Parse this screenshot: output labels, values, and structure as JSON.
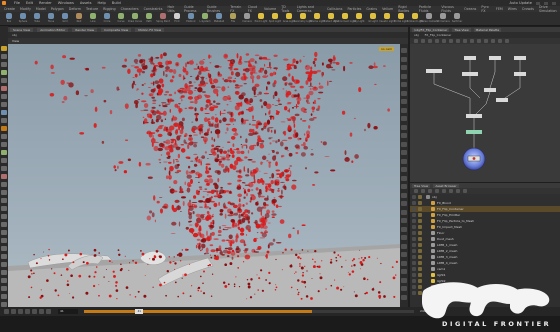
{
  "app": {
    "menu": [
      "File",
      "Edit",
      "Render",
      "Windows",
      "Assets",
      "Help"
    ],
    "desktop": "Build",
    "right_status": "Auto Update"
  },
  "shelf_tabs": [
    "Create",
    "Modify",
    "Model",
    "Polygon",
    "Deform",
    "Texture",
    "Rigging",
    "Characters",
    "Constraints",
    "Hair Utils",
    "Guide Process",
    "Guide Brushes",
    "Terrain FX",
    "Cloud FX",
    "Volume",
    "TD Tools",
    "Lights and Cameras",
    "Collisions",
    "Particles",
    "Grains",
    "Vellum",
    "Rigid Bodies",
    "Particle Fluids",
    "Viscous Fluids",
    "Oceans",
    "Pyro FX",
    "FEM",
    "Wires",
    "Crowds",
    "Drive Simulation"
  ],
  "shelf_tools": [
    {
      "label": "Box",
      "color": "#6f8fb0"
    },
    {
      "label": "Sphere",
      "color": "#6f8fb0"
    },
    {
      "label": "Tube",
      "color": "#6f8fb0"
    },
    {
      "label": "Torus",
      "color": "#6f8fb0"
    },
    {
      "label": "Grid",
      "color": "#6f8fb0"
    },
    {
      "label": "Null",
      "color": "#b08a5a"
    },
    {
      "label": "Line",
      "color": "#8fb06f"
    },
    {
      "label": "Circle",
      "color": "#6f8fb0"
    },
    {
      "label": "Curve",
      "color": "#8fb06f"
    },
    {
      "label": "Draw Curve",
      "color": "#8fb06f"
    },
    {
      "label": "Path",
      "color": "#8fb06f"
    },
    {
      "label": "Spray Paint",
      "color": "#b06f6f"
    },
    {
      "label": "Font",
      "color": "#cfcfcf"
    },
    {
      "label": "Platonic",
      "color": "#6f8fb0"
    },
    {
      "label": "L-System",
      "color": "#8fb06f"
    },
    {
      "label": "Metaball",
      "color": "#6f8fb0"
    },
    {
      "label": "File",
      "color": "#b0a05a"
    },
    {
      "label": "Camera",
      "color": "#9a9a9a"
    },
    {
      "label": "Point Light",
      "color": "#e0c040"
    },
    {
      "label": "Spot Light",
      "color": "#e0c040"
    },
    {
      "label": "Area Light",
      "color": "#e0c040"
    },
    {
      "label": "Geometry Light",
      "color": "#e0c040"
    },
    {
      "label": "Volume Light",
      "color": "#e0c040"
    },
    {
      "label": "Distant Light",
      "color": "#e0c040"
    },
    {
      "label": "Environment Light",
      "color": "#e0c040"
    },
    {
      "label": "Sky Light",
      "color": "#e0c040"
    },
    {
      "label": "GI Light",
      "color": "#e0c040"
    },
    {
      "label": "Caustic Light",
      "color": "#e0c040"
    },
    {
      "label": "Portal Light",
      "color": "#e0c040"
    },
    {
      "label": "Ambient Light",
      "color": "#e0c040"
    },
    {
      "label": "Stereo Camera",
      "color": "#9a9a9a"
    },
    {
      "label": "VR Camera",
      "color": "#9a9a9a"
    },
    {
      "label": "Switcher",
      "color": "#9a9a9a"
    }
  ],
  "viewport": {
    "tabs": [
      "Scene View",
      "Animation Editor",
      "Render View",
      "Composite View",
      "Motion FX View"
    ],
    "path": "obj",
    "view_label": "View",
    "camera_label": "no cam",
    "colors": {
      "particles": "#d81c1c",
      "particles_dark": "#8a0f12",
      "ground": "#b9b9b9"
    }
  },
  "network": {
    "tabs": [
      "/obj/FX_Flip_Container",
      "Tree View",
      "Material Palette"
    ],
    "path": [
      "obj",
      "FX_Flip_Container"
    ],
    "node_label": "FX_Flip_Container"
  },
  "tree": {
    "tabs": [
      "Tree View",
      "Asset Browser"
    ],
    "rows": [
      {
        "label": "obj",
        "depth": 0,
        "color": "#8a8a8a"
      },
      {
        "label": "FX_Blood",
        "depth": 1,
        "color": "#d0a040"
      },
      {
        "label": "FX_Flip_Container",
        "depth": 1,
        "color": "#d0a040",
        "selected": true
      },
      {
        "label": "FX_Flip_Emitter",
        "depth": 1,
        "color": "#d0a040"
      },
      {
        "label": "FX_Flip_Particle_to_Mesh",
        "depth": 1,
        "color": "#d0a040"
      },
      {
        "label": "FX_Impact_Mesh",
        "depth": 1,
        "color": "#d0a040"
      },
      {
        "label": "Floor",
        "depth": 1,
        "color": "#9a9a9a"
      },
      {
        "label": "Dust_mesh",
        "depth": 1,
        "color": "#9a9a9a"
      },
      {
        "label": "LIMB_1_mesh",
        "depth": 1,
        "color": "#9a9a9a"
      },
      {
        "label": "LIMB_2_mesh",
        "depth": 1,
        "color": "#9a9a9a"
      },
      {
        "label": "LIMB_3_mesh",
        "depth": 1,
        "color": "#9a9a9a"
      },
      {
        "label": "LIMB_4_mesh",
        "depth": 1,
        "color": "#9a9a9a"
      },
      {
        "label": "cam1",
        "depth": 1,
        "color": "#9a9a9a"
      },
      {
        "label": "light1",
        "depth": 1,
        "color": "#e0c040"
      },
      {
        "label": "light2",
        "depth": 1,
        "color": "#e0c040"
      },
      {
        "label": "ropnet1",
        "depth": 1,
        "color": "#b06f6f"
      },
      {
        "label": "shopnet1",
        "depth": 1,
        "color": "#6f8fb0"
      }
    ]
  },
  "timeline": {
    "frame": "41",
    "start": 1,
    "end": 240,
    "progress": 0.69,
    "end_label": "240",
    "end_label2": "240"
  },
  "status": {
    "text": ""
  },
  "watermark": {
    "text": "DIGITAL FRONTIER",
    "color": "#f2f2f2"
  }
}
